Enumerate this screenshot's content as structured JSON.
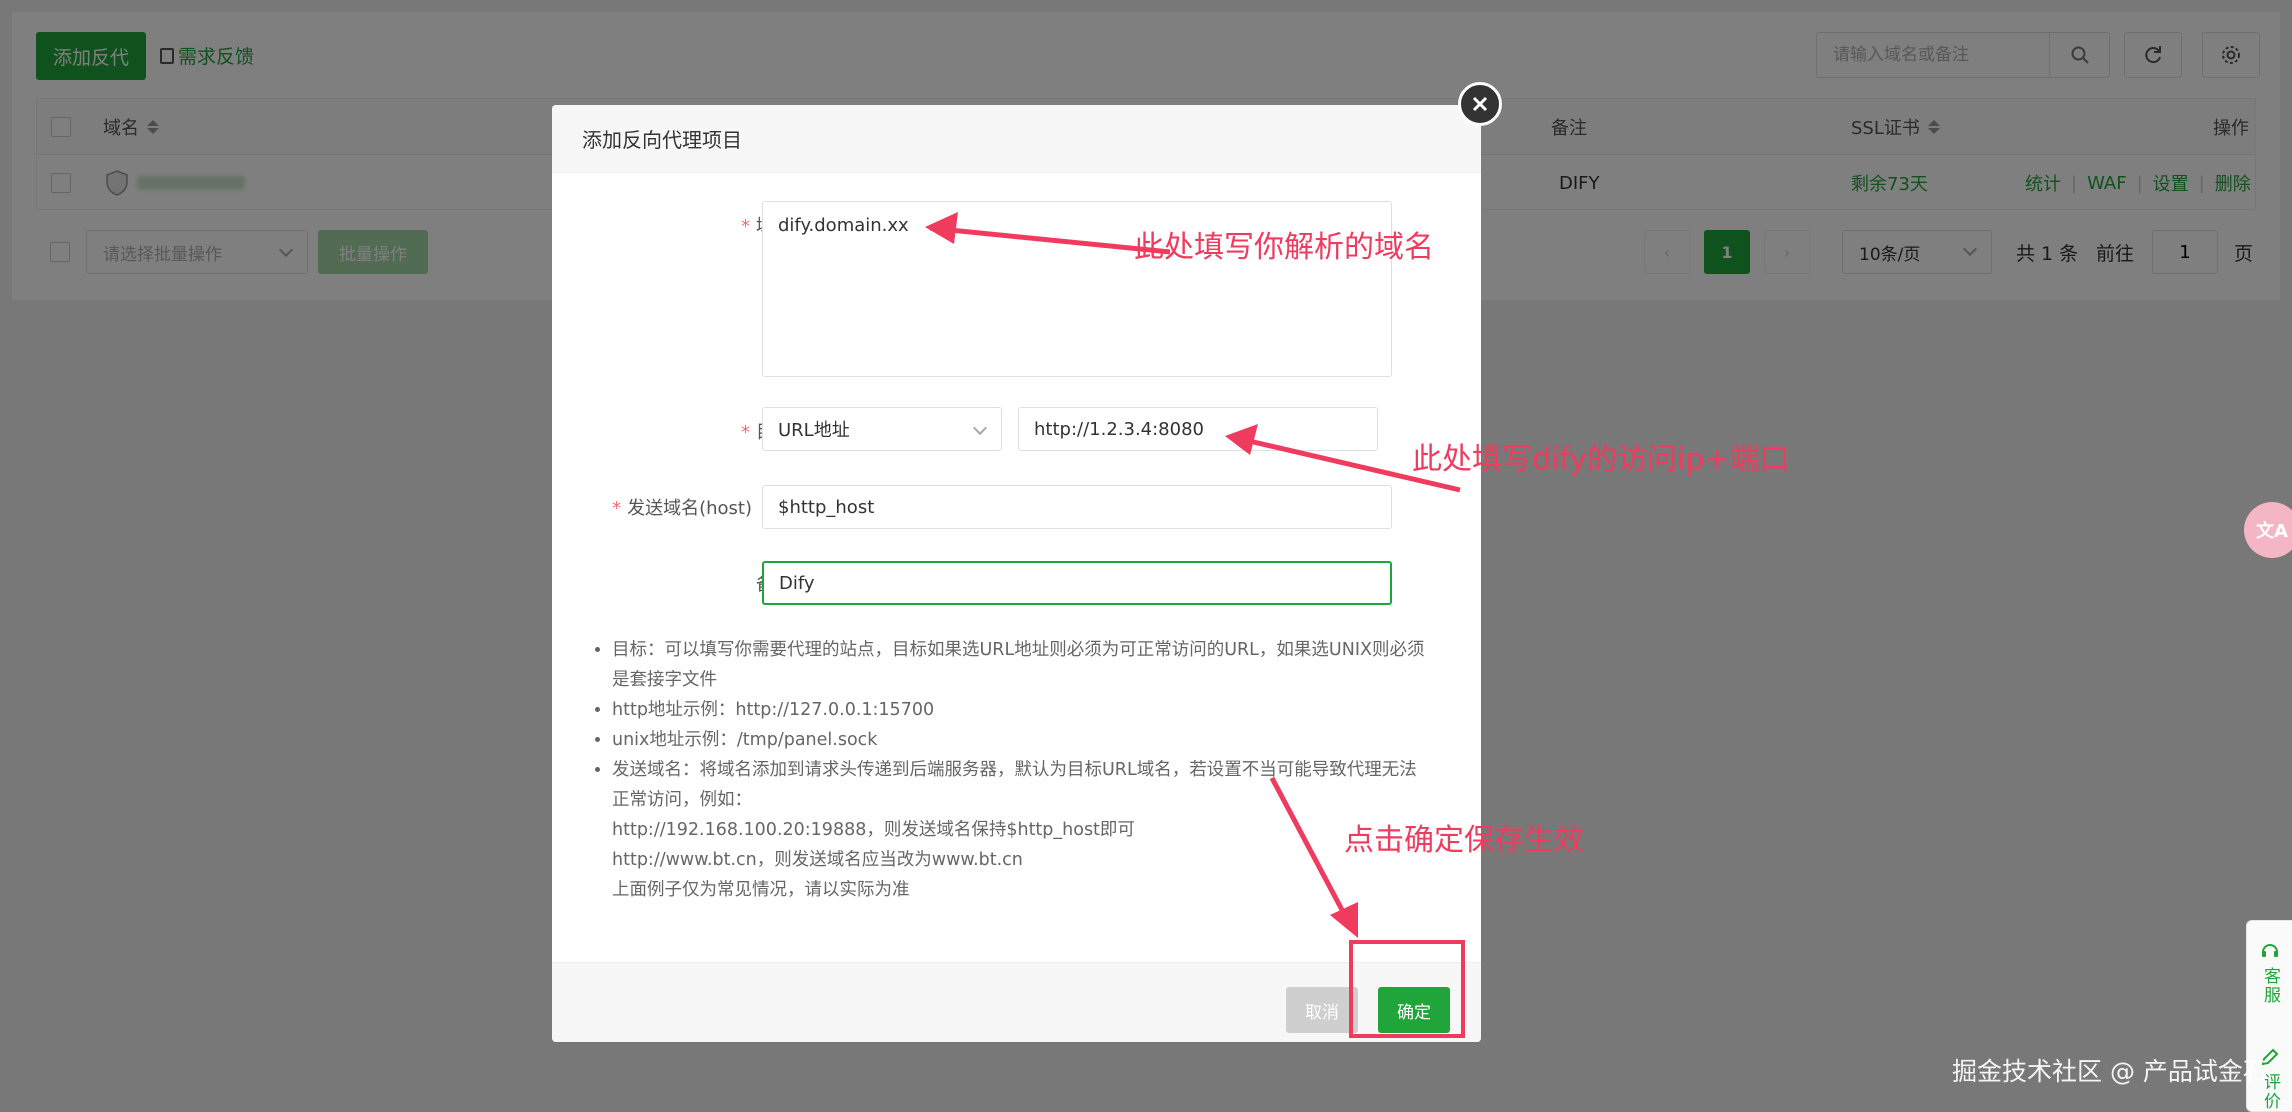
{
  "toolbar": {
    "add_button": "添加反代",
    "feedback_link": "需求反馈",
    "search_placeholder": "请输入域名或备注"
  },
  "table": {
    "headers": {
      "domain": "域名",
      "remark": "备注",
      "ssl": "SSL证书",
      "actions": "操作"
    },
    "rows": [
      {
        "remark": "DIFY",
        "ssl": "剩余73天",
        "actions": [
          "统计",
          "WAF",
          "设置",
          "删除"
        ]
      }
    ]
  },
  "batch": {
    "select_placeholder": "请选择批量操作",
    "button": "批量操作"
  },
  "pagination": {
    "current_page": "1",
    "page_size": "10条/页",
    "total": "共 1 条",
    "goto_label": "前往",
    "goto_value": "1",
    "page_suffix": "页"
  },
  "dialog": {
    "title": "添加反向代理项目",
    "domain_label": "域名",
    "domain_value": "dify.domain.xx",
    "target_label": "目标",
    "target_type": "URL地址",
    "target_value": "http://1.2.3.4:8080",
    "host_label": "发送域名(host)",
    "host_value": "$http_host",
    "remark_label": "备注",
    "remark_value": "Dify",
    "help": [
      "目标：可以填写你需要代理的站点，目标如果选URL地址则必须为可正常访问的URL，如果选UNIX则必须",
      "是套接字文件",
      "http地址示例：http://127.0.0.1:15700",
      "unix地址示例：/tmp/panel.sock",
      "发送域名：将域名添加到请求头传递到后端服务器，默认为目标URL域名，若设置不当可能导致代理无法",
      "正常访问，例如：",
      "http://192.168.100.20:19888，则发送域名保持$http_host即可",
      "http://www.bt.cn，则发送域名应当改为www.bt.cn",
      "上面例子仅为常见情况，请以实际为准"
    ],
    "cancel_button": "取消",
    "confirm_button": "确定"
  },
  "annotations": {
    "domain_note": "此处填写你解析的域名",
    "target_note": "此处填写dify的访问ip+端口",
    "confirm_note": "点击确定保存生效",
    "color": "#ef3b5d"
  },
  "side_widgets": {
    "translate_icon": "文A",
    "service_label": "客服",
    "review_label": "评价"
  },
  "watermark": "掘金技术社区 @ 产品试金石",
  "colors": {
    "brand_green": "#20a53a",
    "annotation_red": "#ef3b5d"
  }
}
